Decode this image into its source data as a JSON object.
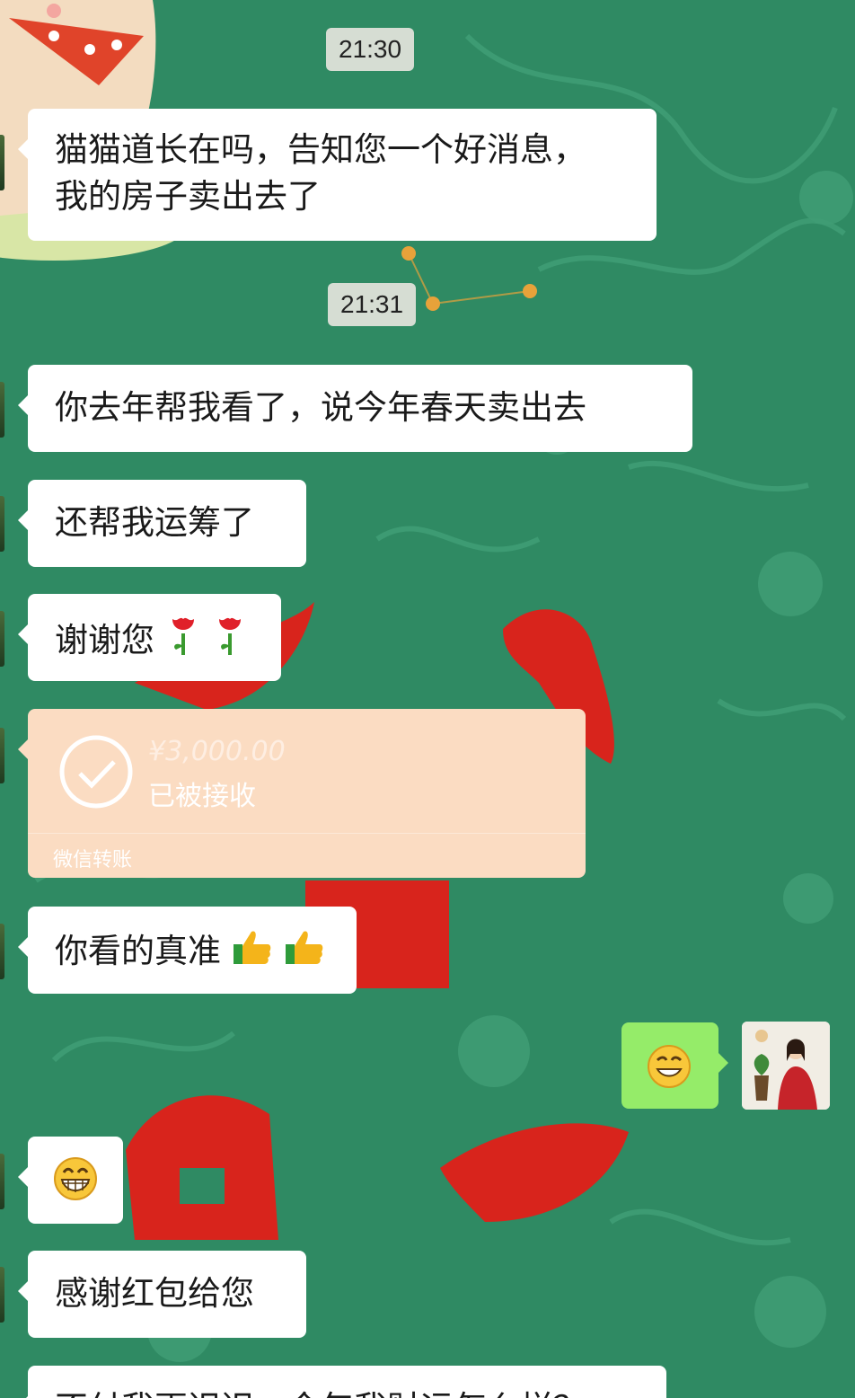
{
  "timestamps": [
    "21:30",
    "21:31"
  ],
  "messages": {
    "m1": {
      "line1": "猫猫道长在吗，告知您一个好消息，",
      "line2": "我的房子卖出去了"
    },
    "m2": "你去年帮我看了，说今年春天卖出去",
    "m3": "还帮我运筹了",
    "m4": "谢谢您",
    "m6": "你看的真准",
    "m9": "感谢红包给您",
    "m10": "不付我更迟迟，今年我财运怎么样？"
  },
  "transfer": {
    "amount": "¥3,000.00",
    "status": "已被接收",
    "brand": "微信转账"
  },
  "icons": {
    "rose": "rose-emoji-icon",
    "thumbs": "thumbs-up-emoji-icon",
    "smirk": "smirk-emoji-icon",
    "grin": "grin-emoji-icon",
    "check": "check-circle-icon"
  },
  "colors": {
    "chat_bg": "#2f8a63",
    "incoming": "#ffffff",
    "outgoing": "#95ec69",
    "transfer_bg": "#fbdcc2",
    "ornament": "#d8241c"
  }
}
